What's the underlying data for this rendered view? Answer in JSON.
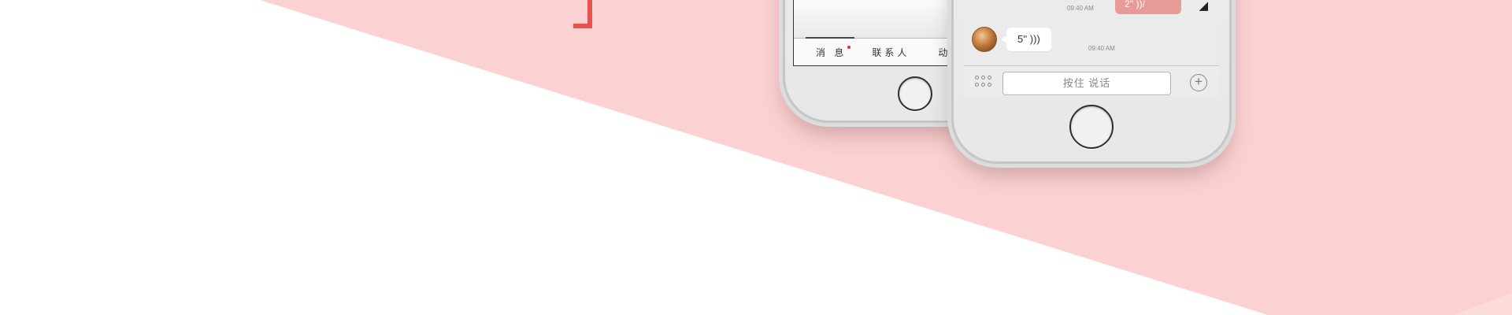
{
  "colors": {
    "background": "#ffffff",
    "pink_band": "#fbd1d1",
    "peach_band": "#fcdcd6",
    "accent_red": "#e8524f",
    "outgoing_bubble": "#e89a97"
  },
  "phone_left": {
    "tabs": [
      {
        "label": "消 息",
        "icon": "red-dot-badge"
      },
      {
        "label": "联系人"
      },
      {
        "label": "动"
      }
    ]
  },
  "phone_right": {
    "messages": [
      {
        "direction": "outgoing",
        "text": "2'' ))/",
        "time": "09:40 AM"
      },
      {
        "direction": "incoming",
        "text": "5'' )))",
        "time": "09:40 AM"
      }
    ],
    "input_bar": {
      "left_icon": "keypad-icon",
      "talk_button": "按住 说话",
      "right_icon": "plus-icon"
    }
  }
}
